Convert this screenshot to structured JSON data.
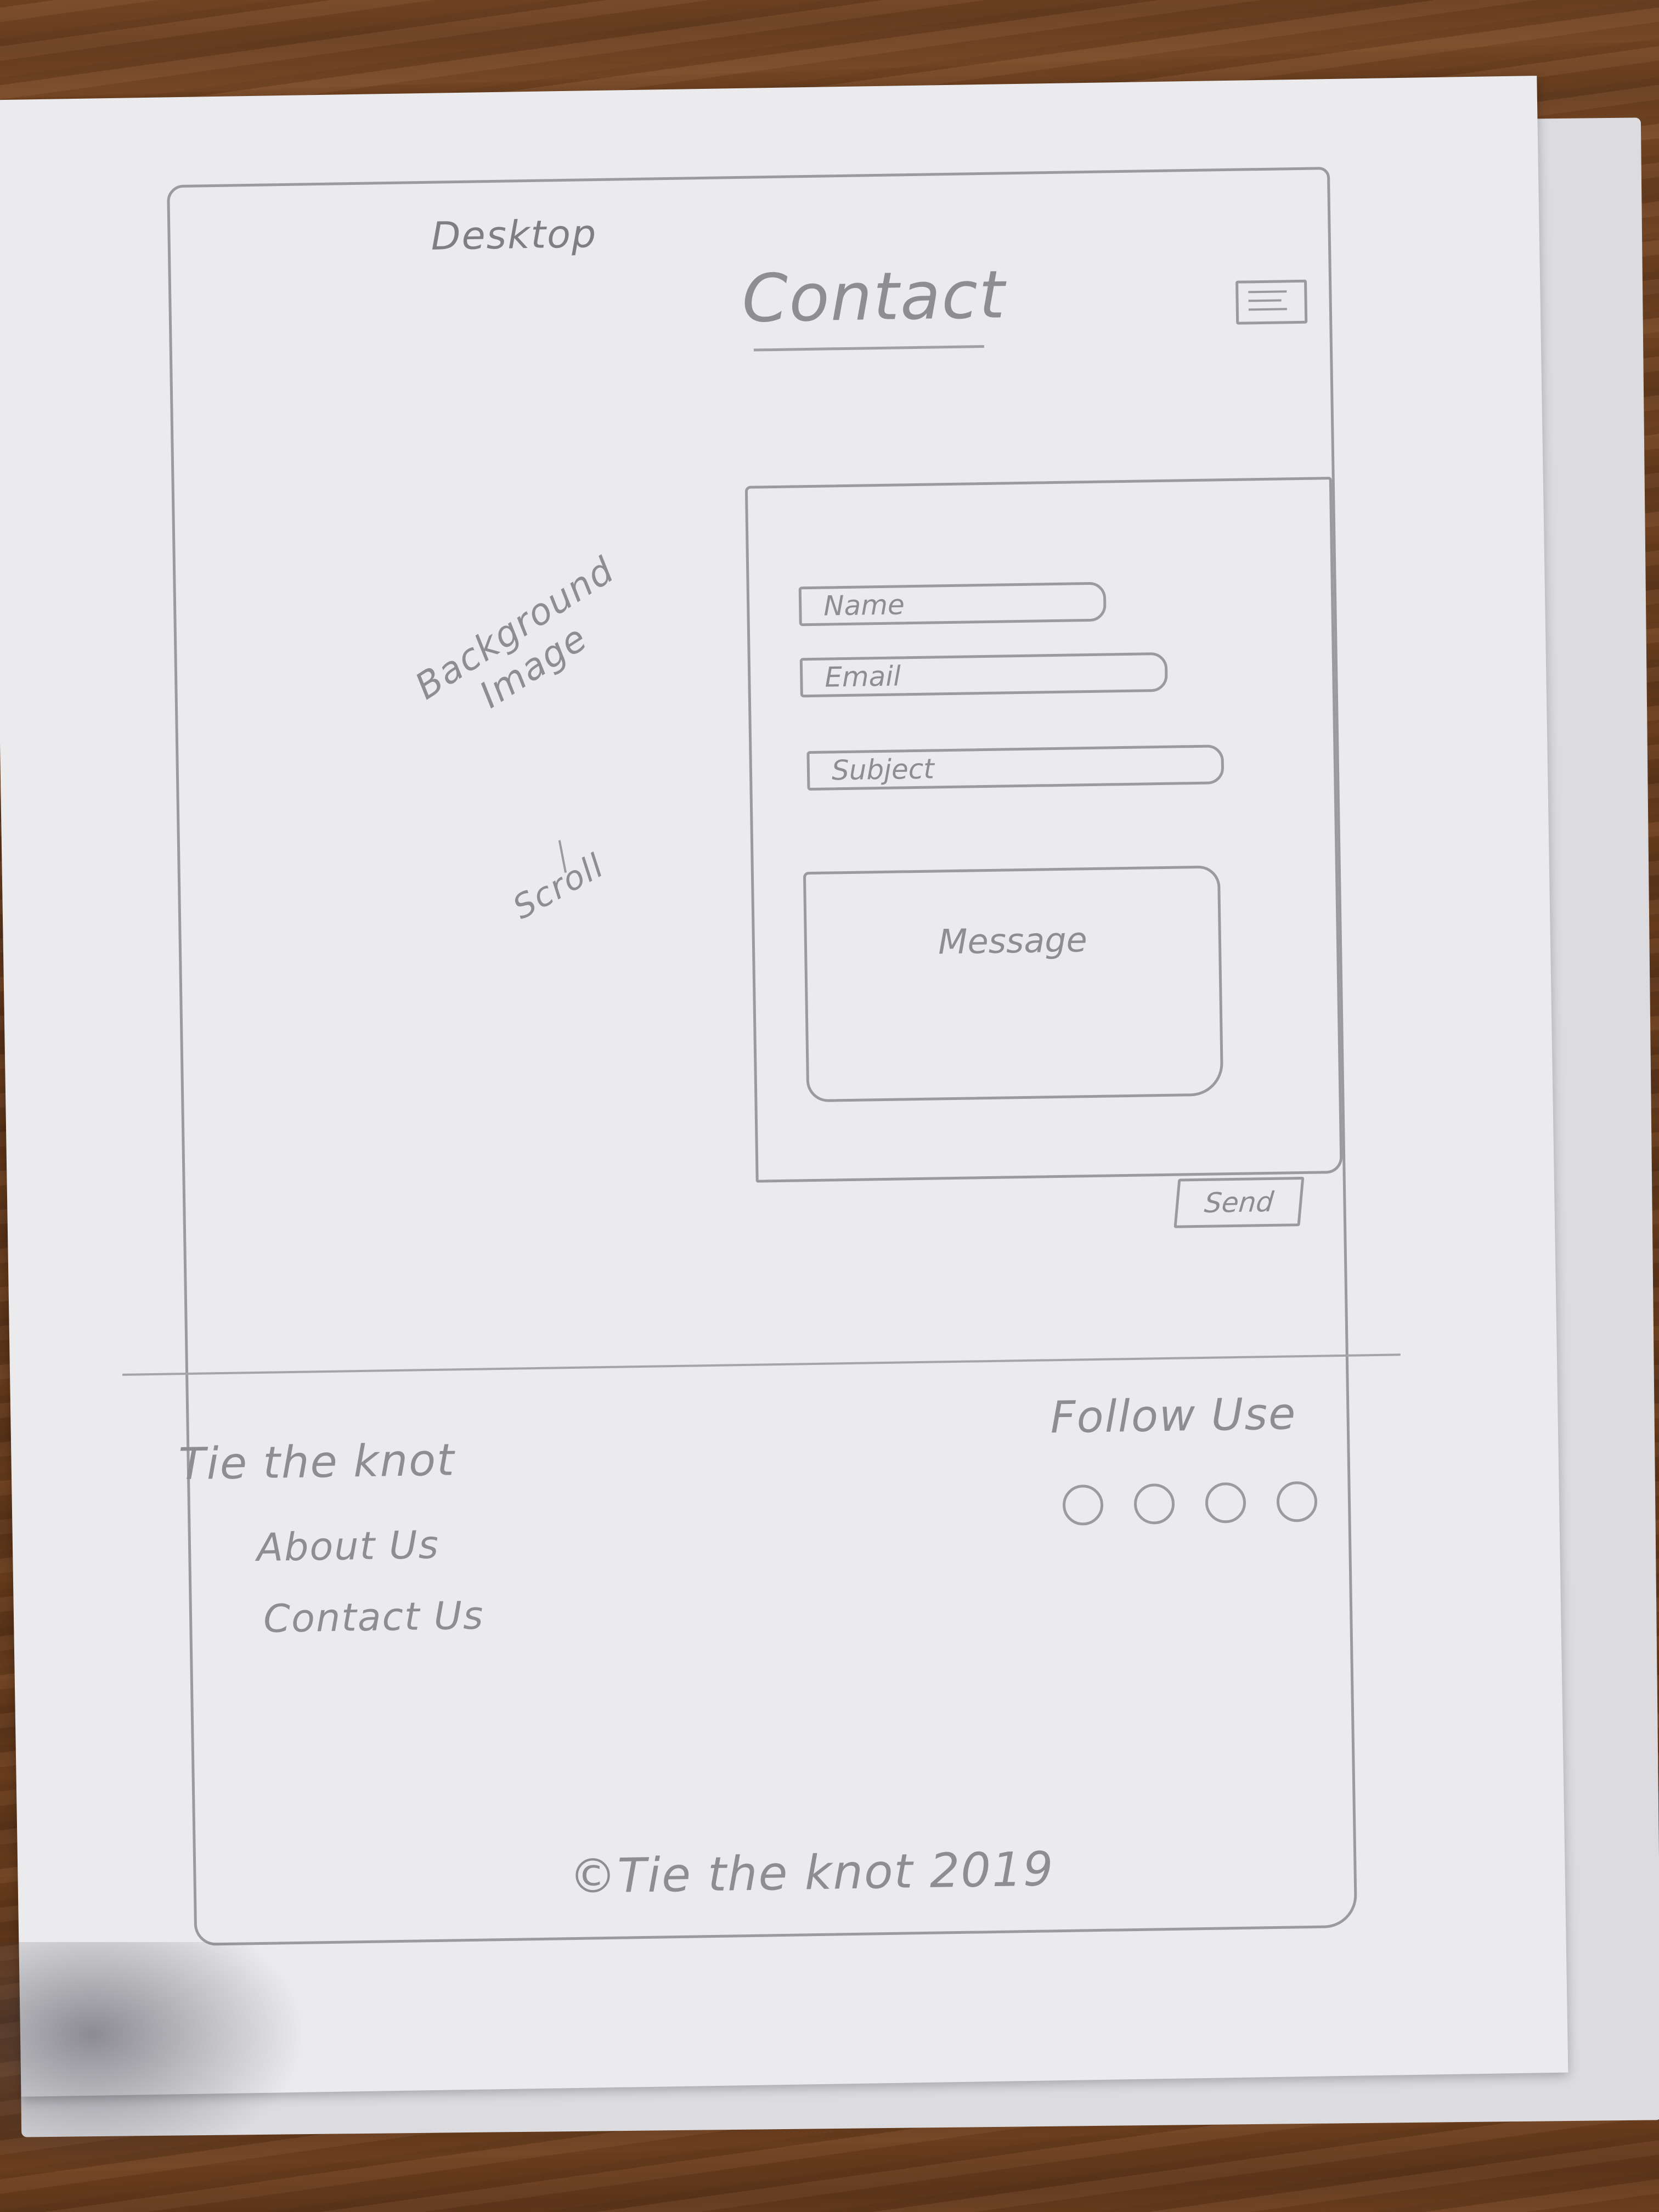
{
  "page_label": "Desktop",
  "header": {
    "title": "Contact",
    "menu_icon": "hamburger-menu-icon"
  },
  "background_note": {
    "line1": "Background",
    "line2": "Image",
    "line3": "Scroll"
  },
  "contact_form": {
    "name_placeholder": "Name",
    "email_placeholder": "Email",
    "subject_placeholder": "Subject",
    "message_placeholder": "Message",
    "send_label": "Send"
  },
  "footer": {
    "brand": "Tie the knot",
    "links": [
      "About Us",
      "Contact Us"
    ],
    "follow_title": "Follow Use",
    "social_icons": [
      "social-icon",
      "social-icon",
      "social-icon",
      "social-icon"
    ],
    "copyright": "©Tie the knot 2019"
  },
  "colors": {
    "pencil": "#9a9aa0",
    "paper": "#ebebee",
    "table": "#6b3f22"
  }
}
